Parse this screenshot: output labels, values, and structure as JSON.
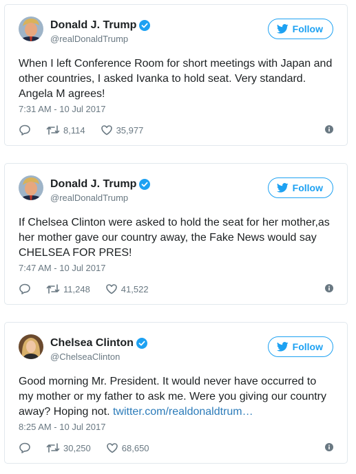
{
  "follow_label": "Follow",
  "colors": {
    "accent": "#1da1f2",
    "meta": "#697882",
    "link": "#2b7bb9",
    "border": "#e1e8ed"
  },
  "icons": [
    "verified-icon",
    "twitter-bird-icon",
    "reply-icon",
    "retweet-icon",
    "like-icon",
    "info-icon"
  ],
  "tweets": [
    {
      "name": "Donald J. Trump",
      "handle": "@realDonaldTrump",
      "text": "When I left Conference Room for short meetings with Japan and other countries, I asked Ivanka to hold seat. Very standard. Angela M agrees!",
      "link": "",
      "timestamp": "7:31 AM - 10 Jul 2017",
      "retweets": "8,114",
      "likes": "35,977"
    },
    {
      "name": "Donald J. Trump",
      "handle": "@realDonaldTrump",
      "text": "If Chelsea Clinton were asked to hold the seat for her mother,as her mother gave our country away, the Fake News would say CHELSEA FOR PRES!",
      "link": "",
      "timestamp": "7:47 AM - 10 Jul 2017",
      "retweets": "11,248",
      "likes": "41,522"
    },
    {
      "name": "Chelsea Clinton",
      "handle": "@ChelseaClinton",
      "text": "Good morning Mr. President. It would never have occurred to my mother or my father to ask me. Were you giving our country away? Hoping not. ",
      "link": "twitter.com/realdonaldtrum…",
      "timestamp": "8:25 AM - 10 Jul 2017",
      "retweets": "30,250",
      "likes": "68,650"
    }
  ]
}
